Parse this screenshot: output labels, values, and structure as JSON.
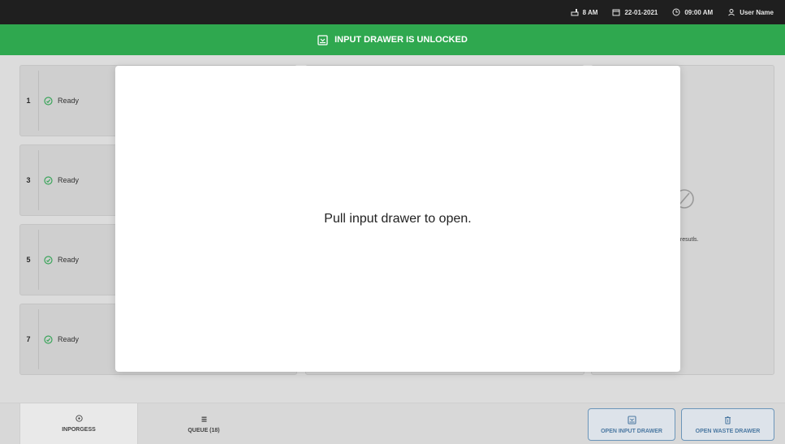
{
  "topbar": {
    "waste_level": "8 AM",
    "date": "22-01-2021",
    "time": "09:00 AM",
    "user": "User Name"
  },
  "banner": {
    "text": "INPUT DRAWER IS UNLOCKED"
  },
  "slots": [
    {
      "number": "1",
      "status": "Ready"
    },
    {
      "number": "3",
      "status": "Ready"
    },
    {
      "number": "5",
      "status": "Ready"
    },
    {
      "number": "7",
      "status": "Ready"
    }
  ],
  "right_panel": {
    "icon": "no-results-icon",
    "text_fragment": "t resutls."
  },
  "modal": {
    "message": "Pull input drawer to open."
  },
  "bottom": {
    "tab_inprogress": "INPORGESS",
    "tab_queue": "QUEUE (18)",
    "btn_open_input": "OPEN INPUT DRAWER",
    "btn_open_waste": "OPEN WASTE DRAWER"
  },
  "colors": {
    "banner": "#2fa84f",
    "topbar": "#1f1f1f",
    "ready_icon": "#3aa55a",
    "button_accent": "#4c79a2"
  }
}
